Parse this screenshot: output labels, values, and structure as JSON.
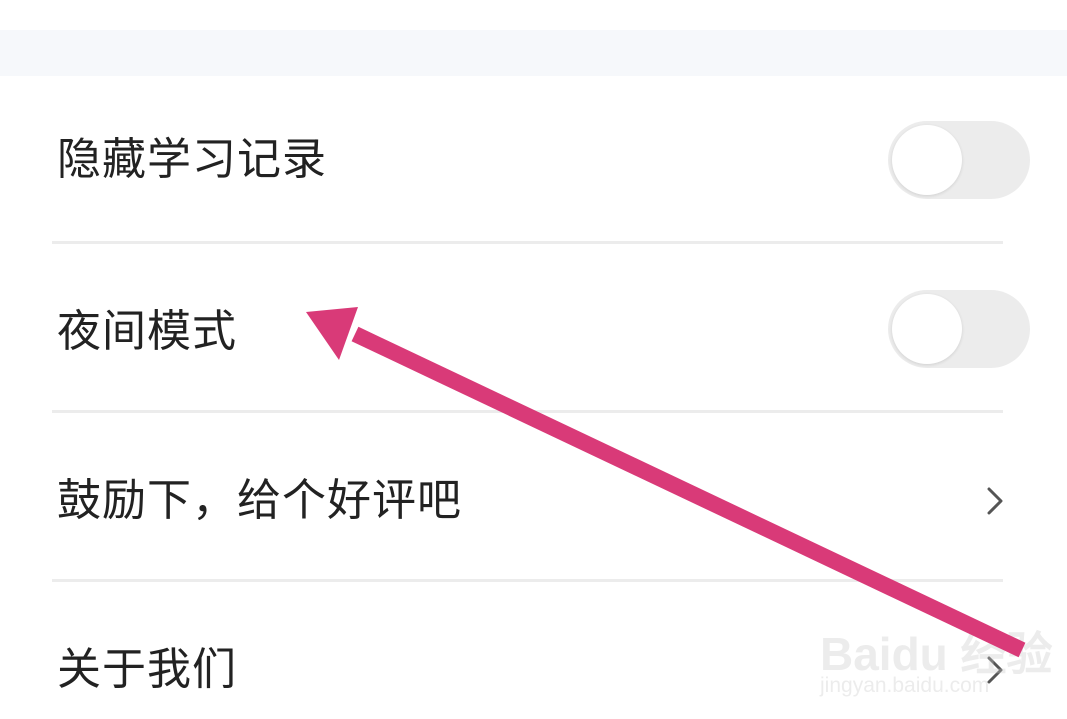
{
  "settings": {
    "items": [
      {
        "label": "隐藏学习记录",
        "control": "toggle",
        "state": "off",
        "icon": "toggle-switch"
      },
      {
        "label": "夜间模式",
        "control": "toggle",
        "state": "off",
        "icon": "toggle-switch"
      },
      {
        "label": "鼓励下，给个好评吧",
        "control": "chevron",
        "icon": "chevron-right-icon"
      },
      {
        "label": "关于我们",
        "control": "chevron",
        "icon": "chevron-right-icon"
      }
    ]
  },
  "annotation": {
    "icon": "arrow-annotation",
    "color": "#d93a78"
  },
  "watermark": {
    "logo": "Baidu 经验",
    "url": "jingyan.baidu.com"
  },
  "colors": {
    "section_band": "#f6f8fb",
    "divider": "#ececec",
    "toggle_off": "#ececec",
    "text": "#222222",
    "chevron": "#555555"
  }
}
